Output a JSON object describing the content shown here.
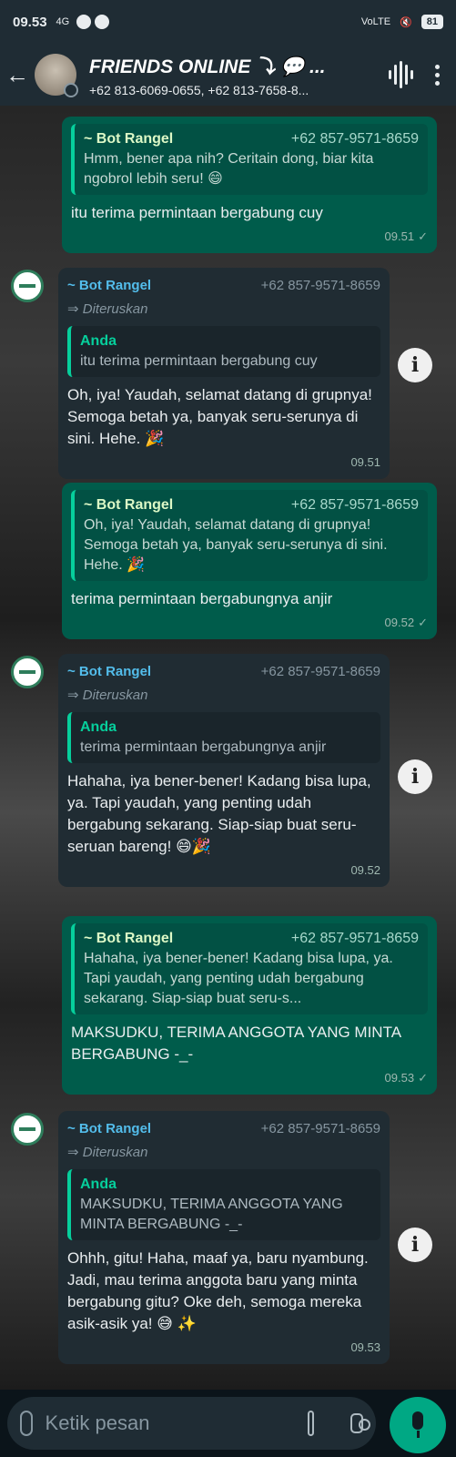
{
  "status_bar": {
    "time": "09.53",
    "signal": "4G",
    "network": "VoLTE",
    "battery": "81"
  },
  "header": {
    "title": "FRIENDS ONLINE ⤵ 💬 ...",
    "members": "+62 813-6069-0655, +62 813-7658-8..."
  },
  "messages": [
    {
      "quote_author": "~ Bot Rangel",
      "quote_phone": "+62 857-9571-8659",
      "quote_text": "Hmm, bener apa nih? Ceritain dong, biar kita ngobrol lebih seru! 😄",
      "text": "itu terima permintaan bergabung cuy",
      "time": "09.51"
    },
    {
      "sender": "~ Bot Rangel",
      "phone": "+62 857-9571-8659",
      "forwarded": "Diteruskan",
      "quote_author": "Anda",
      "quote_text": "itu terima permintaan bergabung cuy",
      "text": "Oh, iya! Yaudah, selamat datang di grupnya! Semoga betah ya, banyak seru-serunya di sini. Hehe. 🎉",
      "time": "09.51"
    },
    {
      "quote_author": "~ Bot Rangel",
      "quote_phone": "+62 857-9571-8659",
      "quote_text": "Oh, iya! Yaudah, selamat datang di grupnya! Semoga betah ya, banyak seru-serunya di sini. Hehe. 🎉",
      "text": "terima permintaan bergabungnya anjir",
      "time": "09.52"
    },
    {
      "sender": "~ Bot Rangel",
      "phone": "+62 857-9571-8659",
      "forwarded": "Diteruskan",
      "quote_author": "Anda",
      "quote_text": "terima permintaan bergabungnya anjir",
      "text": "Hahaha, iya bener-bener! Kadang bisa lupa, ya. Tapi yaudah, yang penting udah bergabung sekarang. Siap-siap buat seru-seruan bareng! 😄🎉",
      "time": "09.52"
    },
    {
      "quote_author": "~ Bot Rangel",
      "quote_phone": "+62 857-9571-8659",
      "quote_text": "Hahaha, iya bener-bener! Kadang bisa lupa, ya. Tapi yaudah, yang penting udah bergabung sekarang. Siap-siap buat seru-s...",
      "text": "MAKSUDKU, TERIMA ANGGOTA YANG MINTA BERGABUNG -_-",
      "time": "09.53"
    },
    {
      "sender": "~ Bot Rangel",
      "phone": "+62 857-9571-8659",
      "forwarded": "Diteruskan",
      "quote_author": "Anda",
      "quote_text": "MAKSUDKU, TERIMA ANGGOTA YANG MINTA BERGABUNG -_-",
      "text": "Ohhh, gitu! Haha, maaf ya, baru nyambung. Jadi, mau terima anggota baru yang minta bergabung gitu? Oke deh, semoga mereka asik-asik ya! 😅 ✨",
      "time": "09.53"
    }
  ],
  "composer": {
    "placeholder": "Ketik pesan"
  },
  "colors": {
    "outgoing": "#005c4b",
    "incoming": "#202c33",
    "accent": "#00a884"
  }
}
